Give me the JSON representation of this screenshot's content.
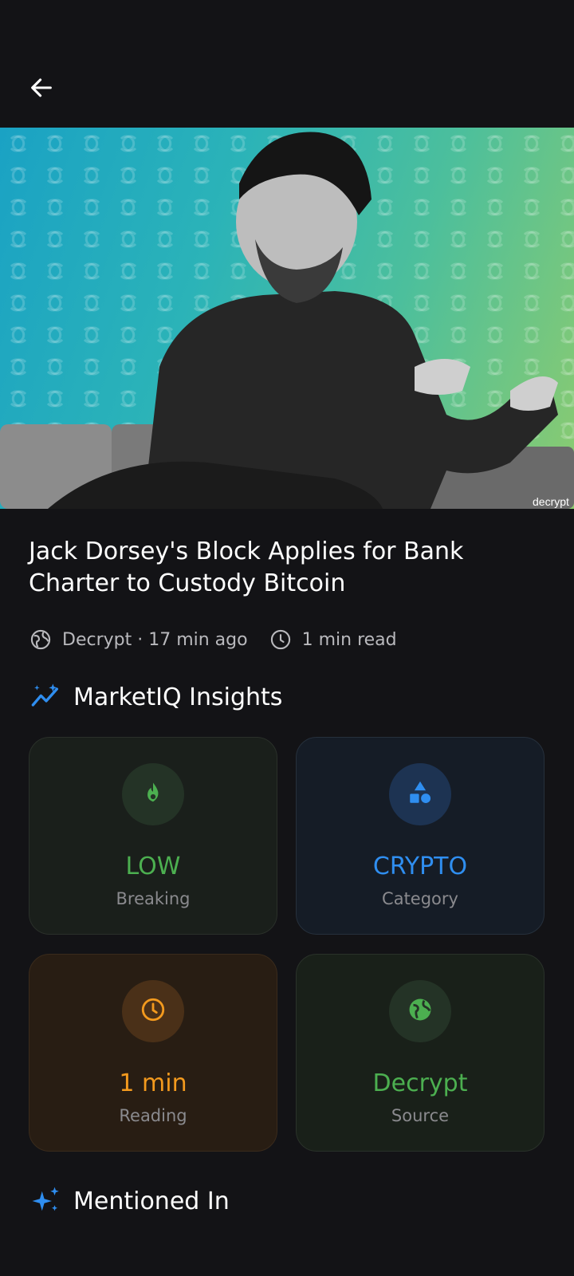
{
  "topbar": {
    "back_icon": "arrow-left-icon"
  },
  "hero": {
    "image_alt": "Jack Dorsey portrait on teal-green patterned background",
    "watermark": "decrypt"
  },
  "article": {
    "title": "Jack Dorsey's Block Applies for Bank Charter to Custody Bitcoin",
    "source_time": "Decrypt · 17 min ago",
    "read_time": "1 min read"
  },
  "insights": {
    "heading": "MarketIQ Insights",
    "cards": [
      {
        "value": "LOW",
        "label": "Breaking",
        "icon": "flame-icon",
        "color": "#4caf50"
      },
      {
        "value": "CRYPTO",
        "label": "Category",
        "icon": "shapes-icon",
        "color": "#2f8ef0"
      },
      {
        "value": "1 min",
        "label": "Reading",
        "icon": "clock-icon",
        "color": "#f39a1e"
      },
      {
        "value": "Decrypt",
        "label": "Source",
        "icon": "globe-icon",
        "color": "#4caf50"
      }
    ]
  },
  "mentioned": {
    "heading": "Mentioned In"
  }
}
